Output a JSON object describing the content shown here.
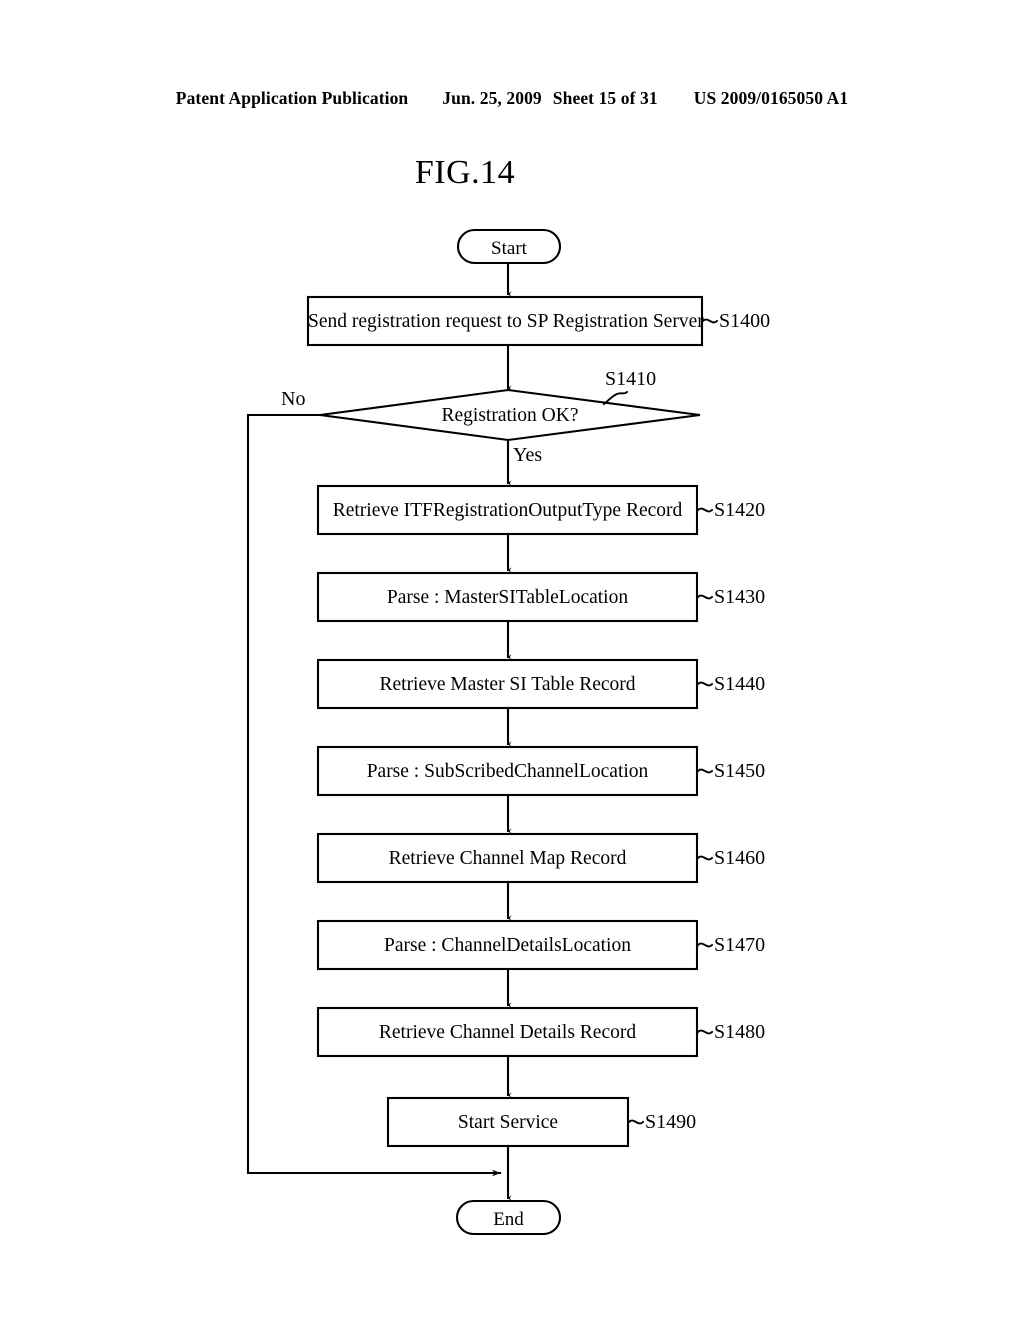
{
  "header": {
    "publication": "Patent Application Publication",
    "date": "Jun. 25, 2009",
    "sheet": "Sheet 15 of 31",
    "patent_number": "US 2009/0165050 A1"
  },
  "figure": {
    "title": "FIG.14"
  },
  "flowchart": {
    "start_label": "Start",
    "end_label": "End",
    "branch_yes": "Yes",
    "branch_no": "No",
    "decision": {
      "text": "Registration OK?",
      "ref": "S1410"
    },
    "steps": [
      {
        "text": "Send registration request to SP Registration Server",
        "ref": "S1400"
      },
      {
        "text": "Retrieve ITFRegistrationOutputType Record",
        "ref": "S1420"
      },
      {
        "text": "Parse : MasterSITableLocation",
        "ref": "S1430"
      },
      {
        "text": "Retrieve Master SI Table Record",
        "ref": "S1440"
      },
      {
        "text": "Parse : SubScribedChannelLocation",
        "ref": "S1450"
      },
      {
        "text": "Retrieve Channel Map Record",
        "ref": "S1460"
      },
      {
        "text": "Parse : ChannelDetailsLocation",
        "ref": "S1470"
      },
      {
        "text": "Retrieve Channel Details Record",
        "ref": "S1480"
      },
      {
        "text": "Start Service",
        "ref": "S1490"
      }
    ]
  },
  "colors": {
    "ink": "#000000",
    "paper": "#ffffff"
  }
}
